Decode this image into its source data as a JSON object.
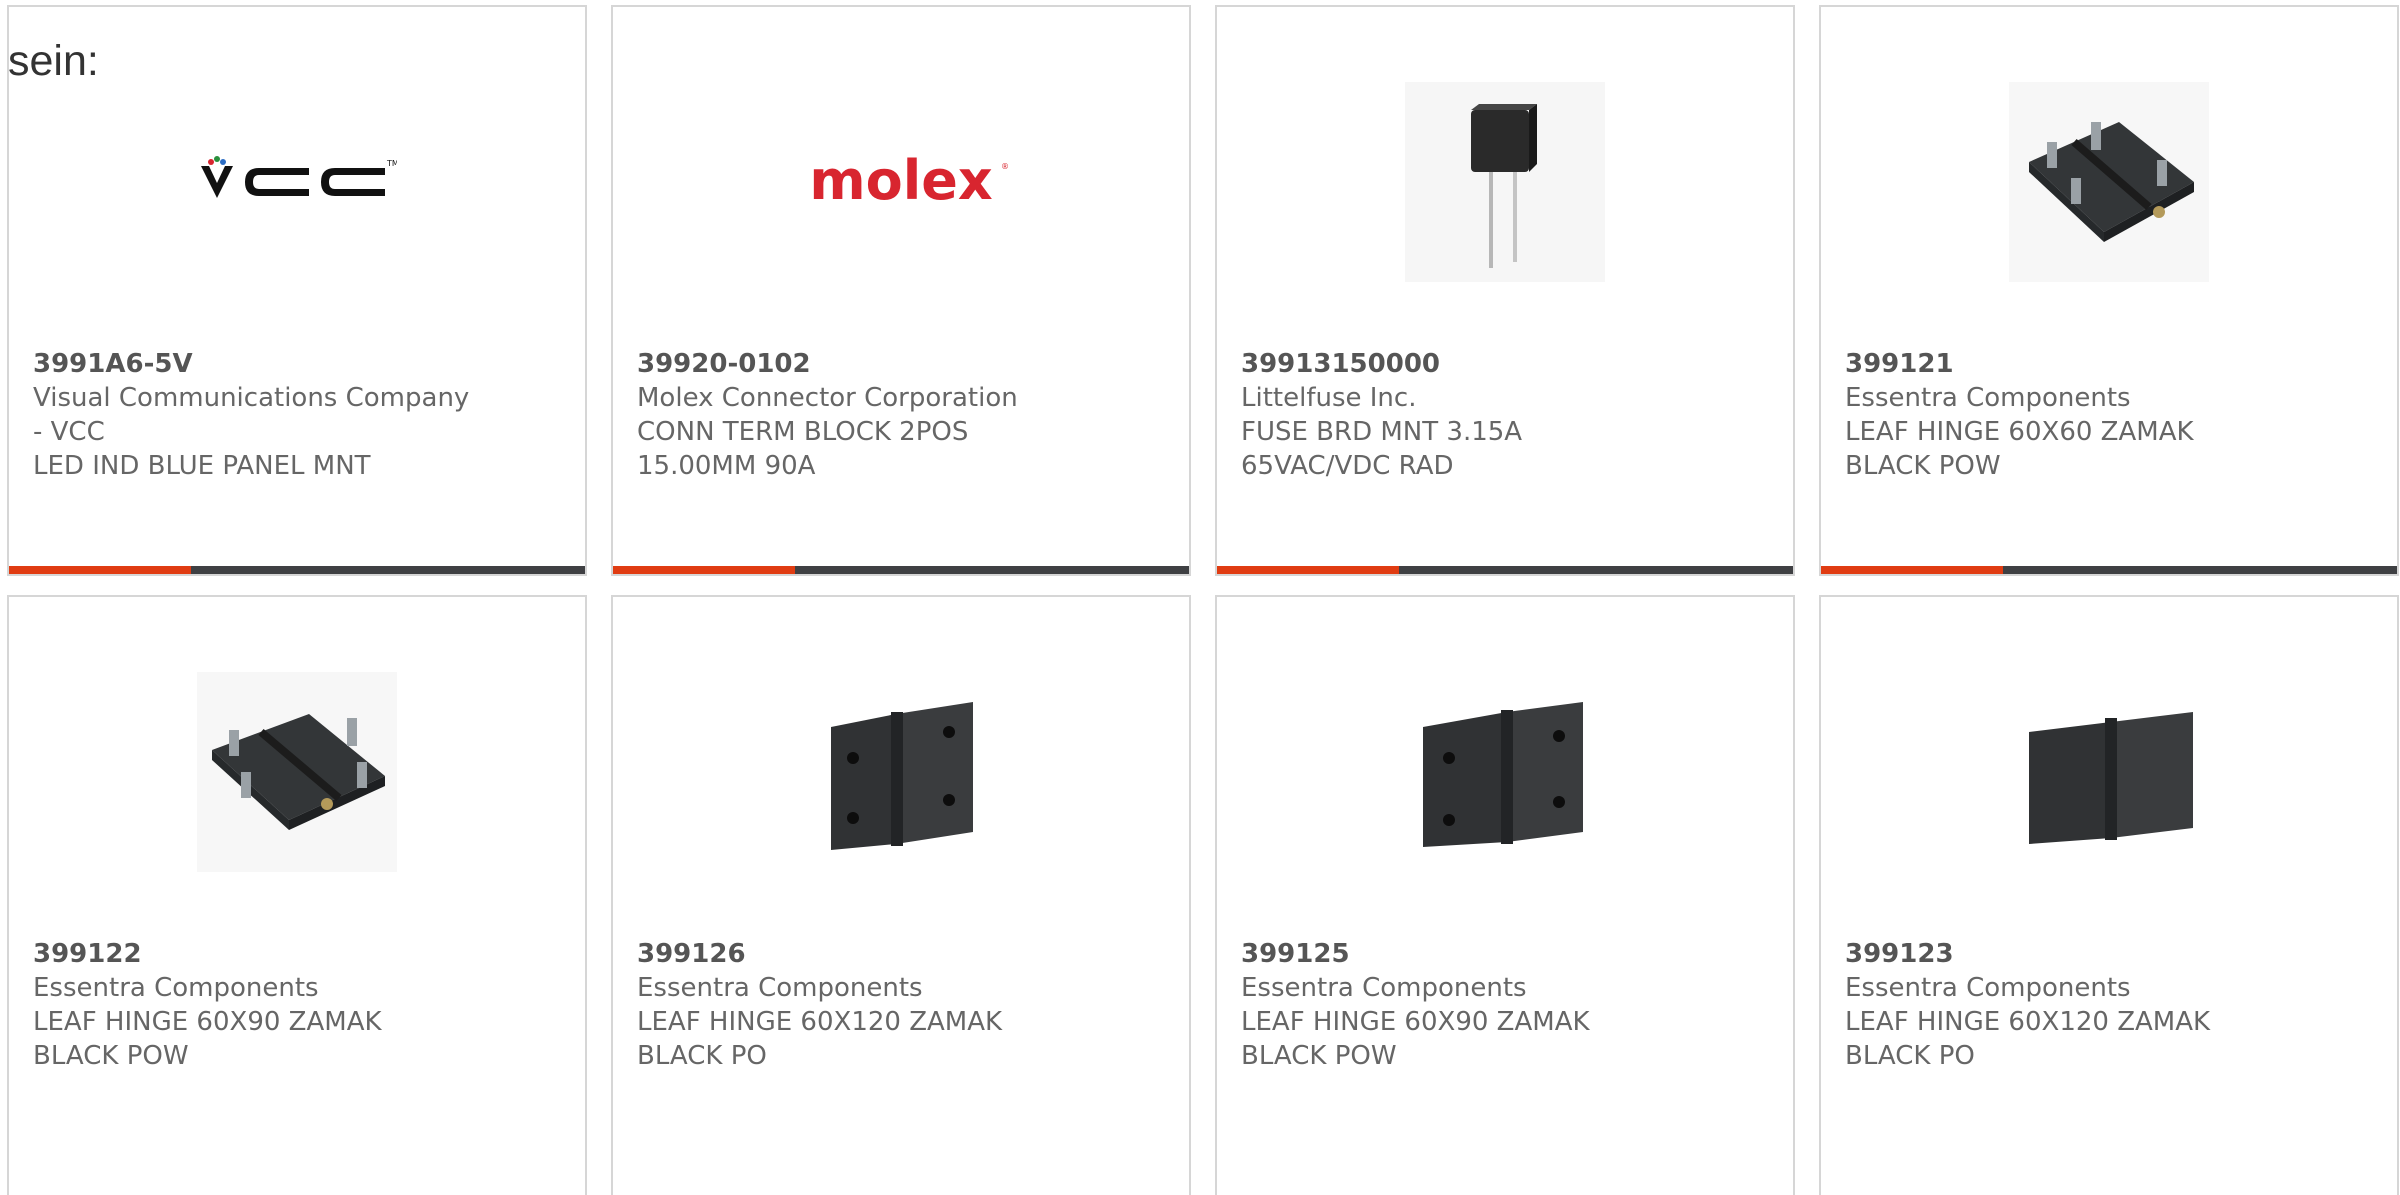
{
  "intro_text": "sein:",
  "brand_colors": {
    "accent": "#e03c12",
    "bar": "#3f4043",
    "molex_red": "#d8252f"
  },
  "vcc_logo_text": "VCC",
  "molex_logo_text": "molex",
  "products": [
    {
      "part_number": "3991A6-5V",
      "manufacturer_line1": "Visual Communications Company",
      "manufacturer_line2": "- VCC",
      "desc_line1": "LED IND BLUE PANEL MNT",
      "desc_line2": "",
      "image": "vcc-logo"
    },
    {
      "part_number": "39920-0102",
      "manufacturer_line1": "Molex Connector Corporation",
      "manufacturer_line2": "",
      "desc_line1": "CONN TERM BLOCK 2POS",
      "desc_line2": "15.00MM 90A",
      "image": "molex-logo"
    },
    {
      "part_number": "39913150000",
      "manufacturer_line1": "Littelfuse Inc.",
      "manufacturer_line2": "",
      "desc_line1": "FUSE BRD MNT 3.15A",
      "desc_line2": "65VAC/VDC RAD",
      "image": "fuse-photo"
    },
    {
      "part_number": "399121",
      "manufacturer_line1": "Essentra Components",
      "manufacturer_line2": "",
      "desc_line1": "LEAF HINGE 60X60 ZAMAK",
      "desc_line2": "BLACK POW",
      "image": "hinge-studs-photo"
    },
    {
      "part_number": "399122",
      "manufacturer_line1": "Essentra Components",
      "manufacturer_line2": "",
      "desc_line1": "LEAF HINGE 60X90 ZAMAK",
      "desc_line2": "BLACK POW",
      "image": "hinge-studs-photo"
    },
    {
      "part_number": "399126",
      "manufacturer_line1": "Essentra Components",
      "manufacturer_line2": "",
      "desc_line1": "LEAF HINGE 60X120 ZAMAK",
      "desc_line2": "BLACK PO",
      "image": "hinge-holes-photo"
    },
    {
      "part_number": "399125",
      "manufacturer_line1": "Essentra Components",
      "manufacturer_line2": "",
      "desc_line1": "LEAF HINGE 60X90 ZAMAK",
      "desc_line2": "BLACK POW",
      "image": "hinge-holes-photo"
    },
    {
      "part_number": "399123",
      "manufacturer_line1": "Essentra Components",
      "manufacturer_line2": "",
      "desc_line1": "LEAF HINGE 60X120 ZAMAK",
      "desc_line2": "BLACK PO",
      "image": "hinge-plain-photo"
    }
  ]
}
